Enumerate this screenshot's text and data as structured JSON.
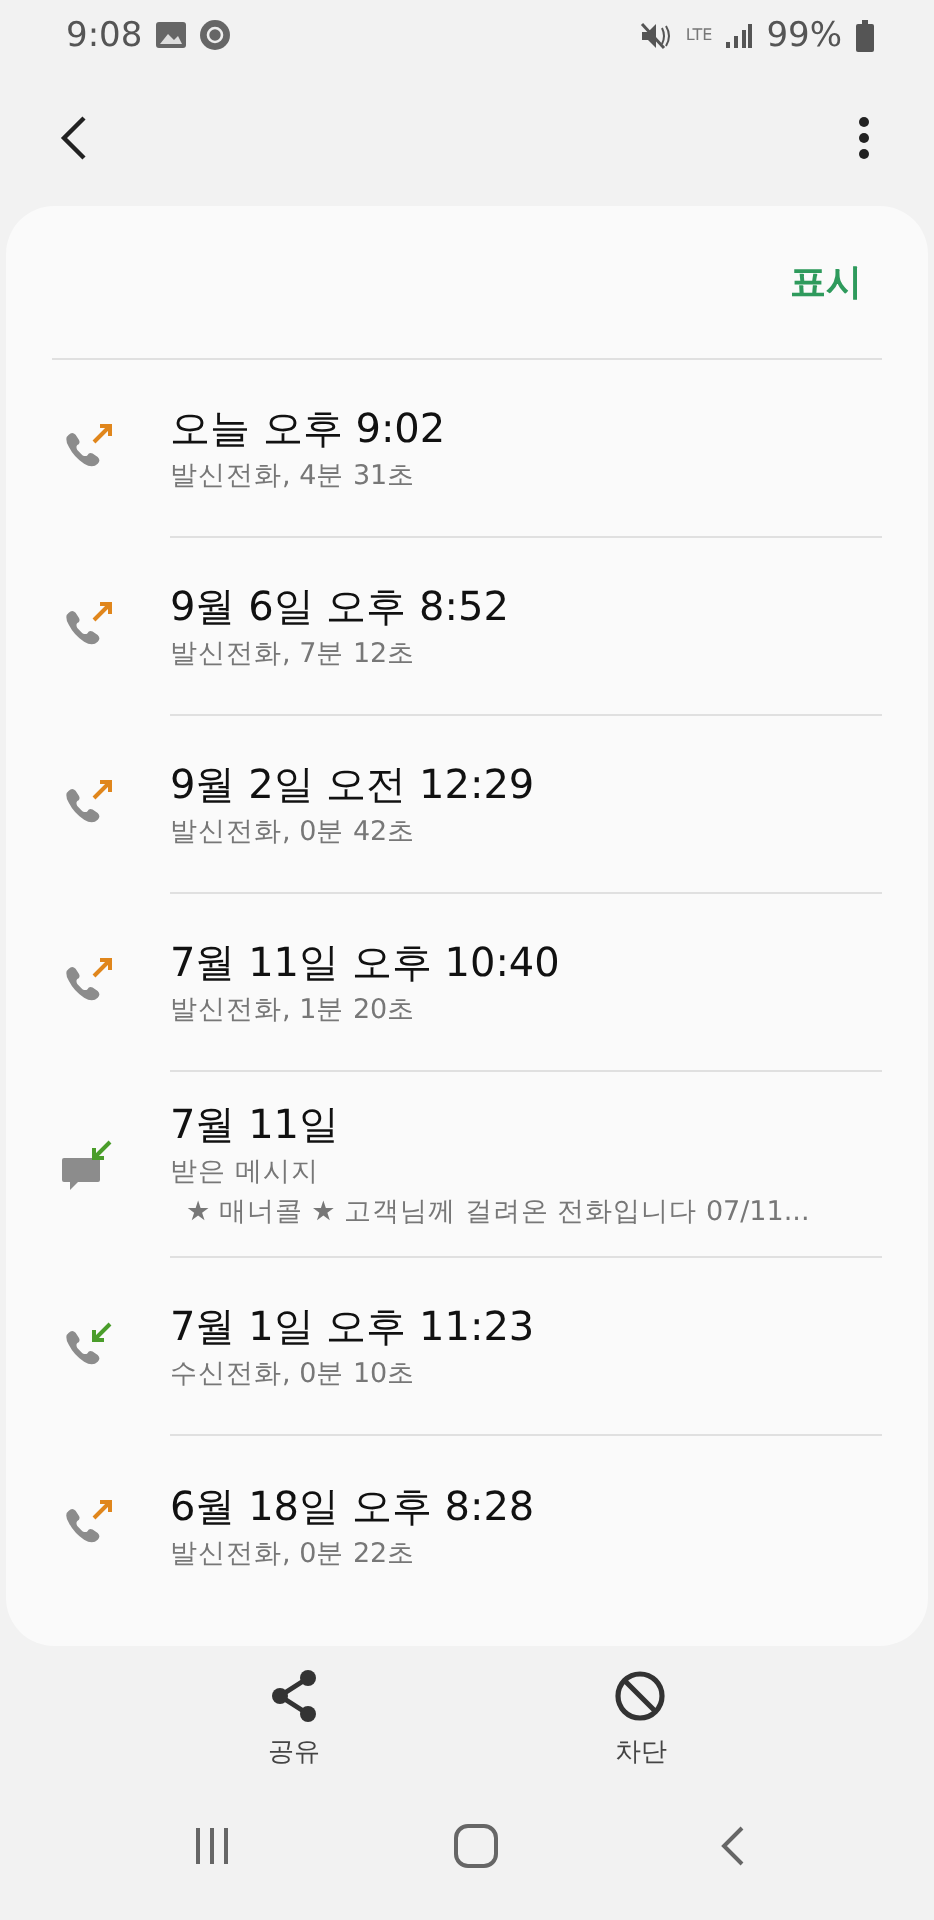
{
  "status_bar": {
    "time": "9:08",
    "network": "LTE",
    "battery": "99%"
  },
  "header_action": "표시",
  "entries": [
    {
      "kind": "outgoing",
      "title": "오늘 오후 9:02",
      "detail": "발신전화, 4분 31초"
    },
    {
      "kind": "outgoing",
      "title": "9월 6일 오후 8:52",
      "detail": "발신전화, 7분 12초"
    },
    {
      "kind": "outgoing",
      "title": "9월 2일 오전 12:29",
      "detail": "발신전화, 0분 42초"
    },
    {
      "kind": "outgoing",
      "title": "7월 11일 오후 10:40",
      "detail": "발신전화, 1분 20초"
    },
    {
      "kind": "message",
      "title": "7월 11일",
      "detail": "받은 메시지",
      "preview": "★ 매너콜 ★  고객님께 걸려온 전화입니다 07/11..."
    },
    {
      "kind": "incoming",
      "title": "7월 1일 오후 11:23",
      "detail": "수신전화, 0분 10초"
    },
    {
      "kind": "outgoing",
      "title": "6월 18일 오후 8:28",
      "detail": "발신전화, 0분 22초"
    }
  ],
  "actions": [
    {
      "kind": "share",
      "label": "공유"
    },
    {
      "kind": "block",
      "label": "차단"
    }
  ]
}
